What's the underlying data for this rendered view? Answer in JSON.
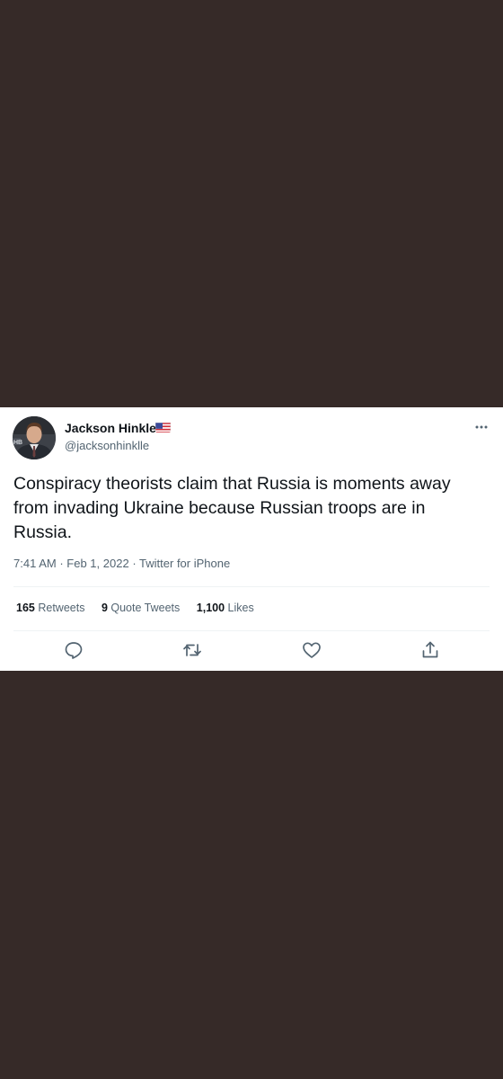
{
  "tweet": {
    "display_name": "Jackson Hinkle",
    "handle": "@jacksonhinklle",
    "text": "Conspiracy theorists claim that Russia is moments away from invading Ukraine because Russian troops are in Russia.",
    "time": "7:41 AM",
    "date": "Feb 1, 2022",
    "source": "Twitter for iPhone",
    "separator": "·"
  },
  "stats": {
    "retweets_count": "165",
    "retweets_label": "Retweets",
    "quotes_count": "9",
    "quotes_label": "Quote Tweets",
    "likes_count": "1,100",
    "likes_label": "Likes"
  },
  "icons": {
    "more": "more-horizontal-icon",
    "flag": "us-flag-icon",
    "reply": "reply-icon",
    "retweet": "retweet-icon",
    "like": "heart-icon",
    "share": "share-icon"
  },
  "colors": {
    "background": "#362a28",
    "card": "#ffffff",
    "text_primary": "#0f1419",
    "text_secondary": "#536471",
    "divider": "#eff3f4"
  }
}
